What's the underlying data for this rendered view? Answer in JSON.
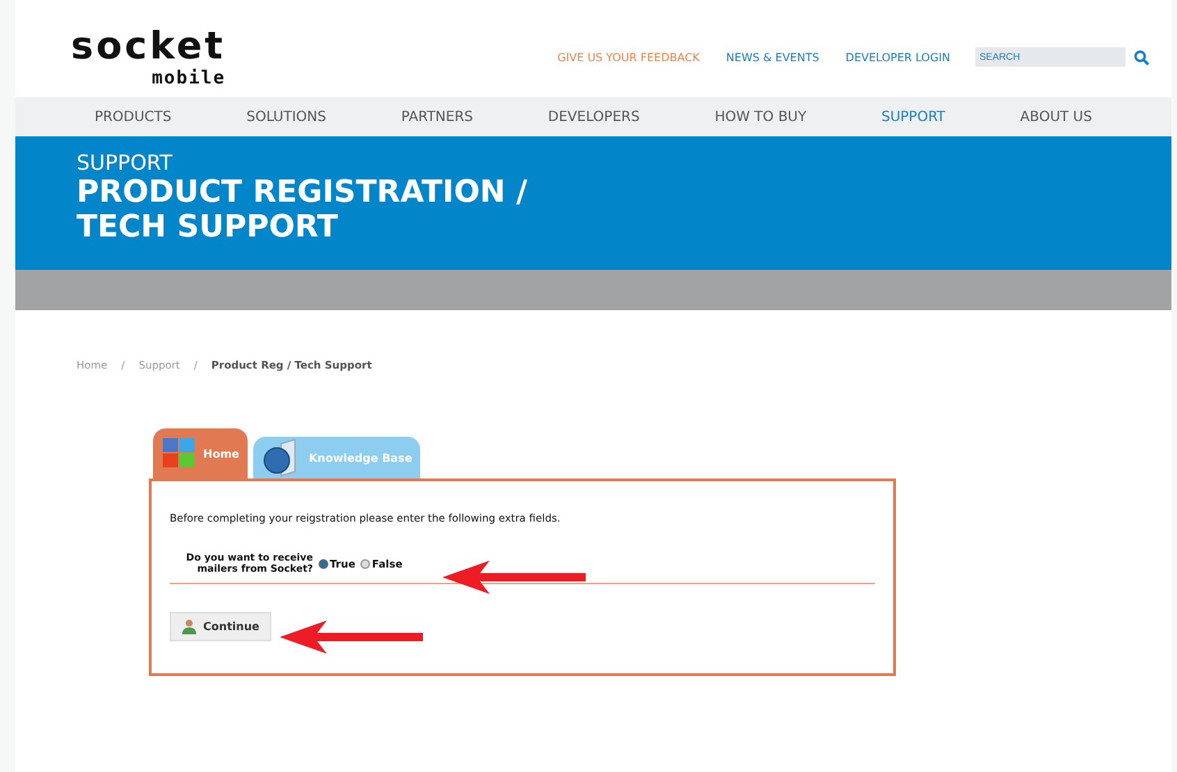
{
  "logo": {
    "line_1": "socket",
    "line_2": "mobile"
  },
  "top_links": [
    {
      "label": "GIVE US YOUR FEEDBACK",
      "kind": "accent"
    },
    {
      "label": "NEWS & EVENTS",
      "kind": "plain"
    },
    {
      "label": "DEVELOPER LOGIN",
      "kind": "plain"
    }
  ],
  "search": {
    "placeholder": "SEARCH"
  },
  "nav": [
    {
      "label": "PRODUCTS",
      "selected": false
    },
    {
      "label": "SOLUTIONS",
      "selected": false
    },
    {
      "label": "PARTNERS",
      "selected": false
    },
    {
      "label": "DEVELOPERS",
      "selected": false
    },
    {
      "label": "HOW TO BUY",
      "selected": false
    },
    {
      "label": "SUPPORT",
      "selected": true
    },
    {
      "label": "ABOUT US",
      "selected": false
    }
  ],
  "banner": {
    "section": "SUPPORT",
    "title_lines": [
      "PRODUCT REGISTRATION /",
      "TECH SUPPORT"
    ]
  },
  "breadcrumb": [
    {
      "label": "Home",
      "current": false
    },
    {
      "separator": "/",
      "label": "Support",
      "current": false
    },
    {
      "separator": "/",
      "label": "Product Reg / Tech Support",
      "current": true
    }
  ],
  "tabs": [
    {
      "label": "Home",
      "selected": true
    },
    {
      "label": "Knowledge Base",
      "selected": false
    }
  ],
  "form": {
    "intro": "Before completing your reigstration please enter the following extra fields.",
    "question_lines": [
      "Do you want to receive",
      "mailers from Socket?"
    ],
    "options": [
      {
        "label": "True",
        "selected": true
      },
      {
        "label": "False",
        "selected": false
      }
    ],
    "button": "Continue"
  }
}
